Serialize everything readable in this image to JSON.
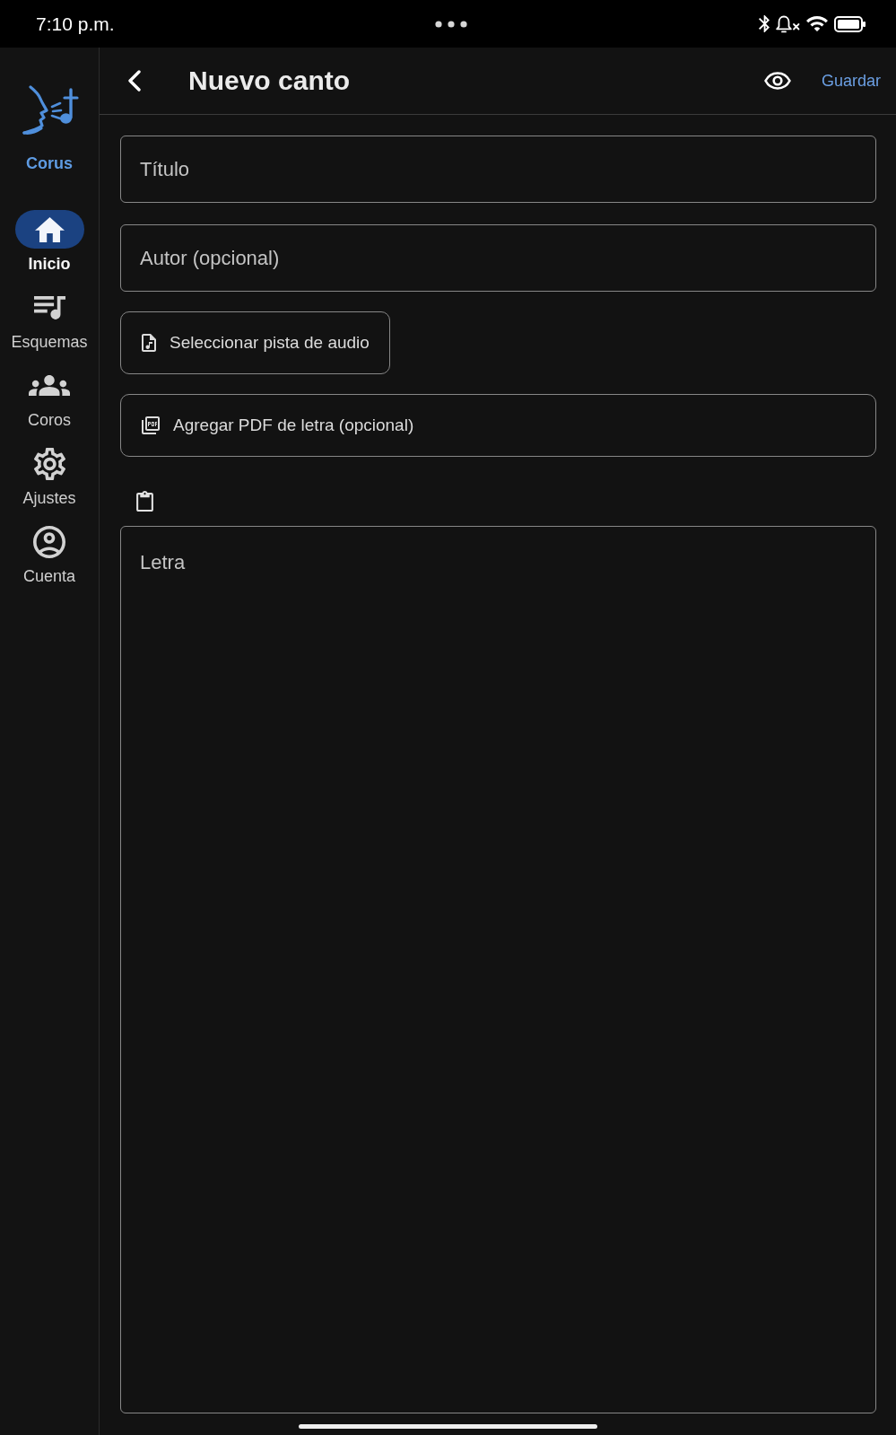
{
  "status_bar": {
    "time": "7:10 p.m."
  },
  "sidebar": {
    "brand": "Corus",
    "items": [
      {
        "kind": "home",
        "label": "Inicio",
        "selected": true
      },
      {
        "kind": "schemes",
        "label": "Esquemas",
        "selected": false
      },
      {
        "kind": "choirs",
        "label": "Coros",
        "selected": false
      },
      {
        "kind": "settings",
        "label": "Ajustes",
        "selected": false
      },
      {
        "kind": "account",
        "label": "Cuenta",
        "selected": false
      }
    ]
  },
  "header": {
    "title": "Nuevo canto",
    "save_label": "Guardar"
  },
  "form": {
    "fields": [
      {
        "placeholder": "Título"
      },
      {
        "placeholder": "Autor (opcional)"
      }
    ],
    "attachments": [
      {
        "kind": "audio",
        "label": "Seleccionar pista de audio"
      },
      {
        "kind": "pdf",
        "label": "Agregar PDF de letra (opcional)"
      }
    ],
    "lyrics": {
      "placeholder": "Letra"
    }
  }
}
